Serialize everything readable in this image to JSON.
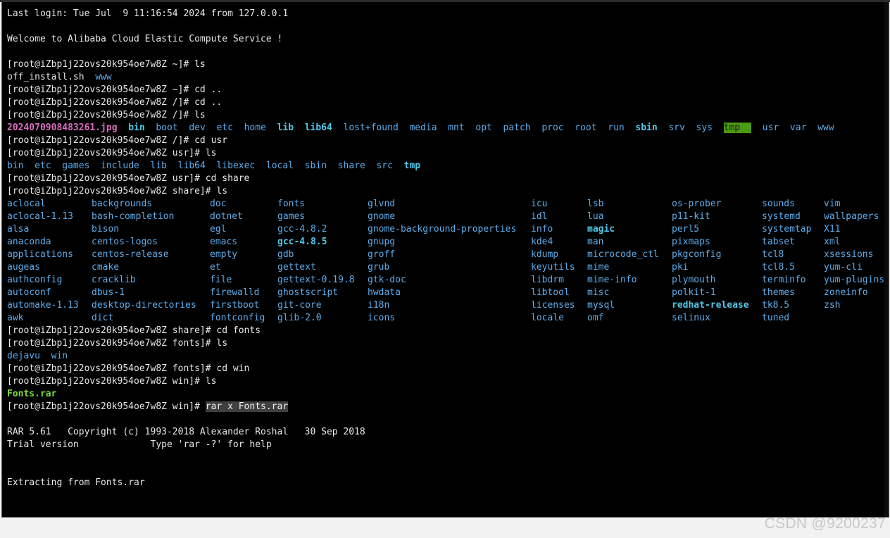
{
  "terminal": {
    "prompt_user": "root",
    "prompt_host": "iZbp1j22ovs20k954oe7w8Z",
    "lines": [
      {
        "type": "text",
        "text": "Last login: Tue Jul  9 11:16:54 2024 from 127.0.0.1"
      },
      {
        "type": "blank"
      },
      {
        "type": "text",
        "text": "Welcome to Alibaba Cloud Elastic Compute Service !"
      },
      {
        "type": "blank"
      },
      {
        "type": "prompt",
        "text": "[root@iZbp1j22ovs20k954oe7w8Z ~]# ls"
      },
      {
        "type": "row",
        "items": [
          {
            "t": "off_install.sh",
            "c": ""
          },
          {
            "t": "www",
            "c": "dir"
          }
        ]
      },
      {
        "type": "prompt",
        "text": "[root@iZbp1j22ovs20k954oe7w8Z ~]# cd .."
      },
      {
        "type": "prompt",
        "text": "[root@iZbp1j22ovs20k954oe7w8Z /]# cd .."
      },
      {
        "type": "prompt",
        "text": "[root@iZbp1j22ovs20k954oe7w8Z /]# ls"
      },
      {
        "type": "row",
        "items": [
          {
            "t": "2024070908483261.jpg",
            "c": "img"
          },
          {
            "t": "bin",
            "c": "bolddir"
          },
          {
            "t": "boot",
            "c": "dir"
          },
          {
            "t": "dev",
            "c": "dir"
          },
          {
            "t": "etc",
            "c": "dir"
          },
          {
            "t": "home",
            "c": "dir"
          },
          {
            "t": "lib",
            "c": "bolddir"
          },
          {
            "t": "lib64",
            "c": "bolddir"
          },
          {
            "t": "lost+found",
            "c": "dir"
          },
          {
            "t": "media",
            "c": "dir"
          },
          {
            "t": "mnt",
            "c": "dir"
          },
          {
            "t": "opt",
            "c": "dir"
          },
          {
            "t": "patch",
            "c": "dir"
          },
          {
            "t": "proc",
            "c": "dir"
          },
          {
            "t": "root",
            "c": "dir"
          },
          {
            "t": "run",
            "c": "dir"
          },
          {
            "t": "sbin",
            "c": "bolddir"
          },
          {
            "t": "srv",
            "c": "dir"
          },
          {
            "t": "sys",
            "c": "dir"
          },
          {
            "t": "tmp",
            "c": "tmp"
          },
          {
            "t": "usr",
            "c": "dir"
          },
          {
            "t": "var",
            "c": "dir"
          },
          {
            "t": "www",
            "c": "dir"
          }
        ]
      },
      {
        "type": "prompt",
        "text": "[root@iZbp1j22ovs20k954oe7w8Z /]# cd usr"
      },
      {
        "type": "prompt",
        "text": "[root@iZbp1j22ovs20k954oe7w8Z usr]# ls"
      },
      {
        "type": "row",
        "items": [
          {
            "t": "bin",
            "c": "dir"
          },
          {
            "t": "etc",
            "c": "dir"
          },
          {
            "t": "games",
            "c": "dir"
          },
          {
            "t": "include",
            "c": "dir"
          },
          {
            "t": "lib",
            "c": "dir"
          },
          {
            "t": "lib64",
            "c": "dir"
          },
          {
            "t": "libexec",
            "c": "dir"
          },
          {
            "t": "local",
            "c": "dir"
          },
          {
            "t": "sbin",
            "c": "dir"
          },
          {
            "t": "share",
            "c": "dir"
          },
          {
            "t": "src",
            "c": "dir"
          },
          {
            "t": "tmp",
            "c": "bolddir"
          }
        ]
      },
      {
        "type": "prompt",
        "text": "[root@iZbp1j22ovs20k954oe7w8Z usr]# cd share"
      },
      {
        "type": "prompt",
        "text": "[root@iZbp1j22ovs20k954oe7w8Z share]# ls"
      },
      {
        "type": "grid",
        "cols": [
          [
            "aclocal",
            "backgrounds",
            "doc",
            "fonts",
            "glvnd",
            "icu",
            "lsb",
            "os-prober",
            "sounds",
            "vim"
          ],
          [
            "aclocal-1.13",
            "bash-completion",
            "dotnet",
            "games",
            "gnome",
            "idl",
            "lua",
            "p11-kit",
            "systemd",
            "wallpapers"
          ],
          [
            "alsa",
            "bison",
            "egl",
            "gcc-4.8.2",
            "gnome-background-properties",
            "info",
            "magic",
            "perl5",
            "systemtap",
            "X11"
          ],
          [
            "anaconda",
            "centos-logos",
            "emacs",
            "gcc-4.8.5",
            "gnupg",
            "kde4",
            "man",
            "pixmaps",
            "tabset",
            "xml"
          ],
          [
            "applications",
            "centos-release",
            "empty",
            "gdb",
            "groff",
            "kdump",
            "microcode_ctl",
            "pkgconfig",
            "tcl8",
            "xsessions"
          ],
          [
            "augeas",
            "cmake",
            "et",
            "gettext",
            "grub",
            "keyutils",
            "mime",
            "pki",
            "tcl8.5",
            "yum-cli"
          ],
          [
            "authconfig",
            "cracklib",
            "file",
            "gettext-0.19.8",
            "gtk-doc",
            "libdrm",
            "mime-info",
            "plymouth",
            "terminfo",
            "yum-plugins"
          ],
          [
            "autoconf",
            "dbus-1",
            "firewalld",
            "ghostscript",
            "hwdata",
            "libtool",
            "misc",
            "polkit-1",
            "themes",
            "zoneinfo"
          ],
          [
            "automake-1.13",
            "desktop-directories",
            "firstboot",
            "git-core",
            "i18n",
            "licenses",
            "mysql",
            "redhat-release",
            "tk8.5",
            "zsh"
          ],
          [
            "awk",
            "dict",
            "fontconfig",
            "glib-2.0",
            "icons",
            "locale",
            "omf",
            "selinux",
            "tuned",
            ""
          ]
        ],
        "bold": [
          "gcc-4.8.5",
          "magic",
          "redhat-release"
        ]
      },
      {
        "type": "prompt",
        "text": "[root@iZbp1j22ovs20k954oe7w8Z share]# cd fonts"
      },
      {
        "type": "prompt",
        "text": "[root@iZbp1j22ovs20k954oe7w8Z fonts]# ls"
      },
      {
        "type": "row",
        "items": [
          {
            "t": "dejavu",
            "c": "dir"
          },
          {
            "t": "win",
            "c": "dir"
          }
        ]
      },
      {
        "type": "prompt",
        "text": "[root@iZbp1j22ovs20k954oe7w8Z fonts]# cd win"
      },
      {
        "type": "prompt",
        "text": "[root@iZbp1j22ovs20k954oe7w8Z win]# ls"
      },
      {
        "type": "row",
        "items": [
          {
            "t": "Fonts.rar",
            "c": "exe"
          }
        ]
      },
      {
        "type": "hlprompt",
        "prefix": "[root@iZbp1j22ovs20k954oe7w8Z win]# ",
        "cmd": "rar x Fonts.rar"
      },
      {
        "type": "blank"
      },
      {
        "type": "text",
        "text": "RAR 5.61   Copyright (c) 1993-2018 Alexander Roshal   30 Sep 2018"
      },
      {
        "type": "text",
        "text": "Trial version             Type 'rar -?' for help"
      },
      {
        "type": "blank"
      },
      {
        "type": "blank"
      },
      {
        "type": "text",
        "text": "Extracting from Fonts.rar"
      }
    ]
  },
  "colors": {
    "background": "#000000",
    "foreground": "#e8e8e8",
    "directory": "#5dadeb",
    "executable": "#7cdc3c",
    "image": "#d96dc0",
    "tmp_highlight": "#4a9a12"
  },
  "watermark": "CSDN @9200237"
}
